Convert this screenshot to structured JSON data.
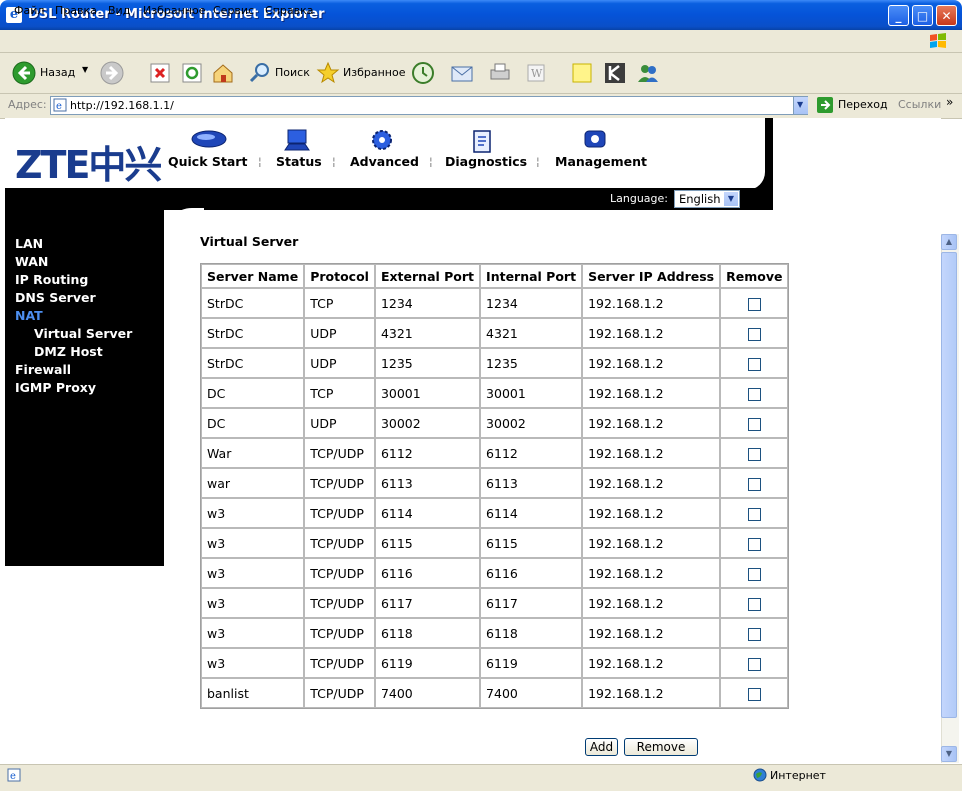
{
  "window": {
    "title": "DSL Router - Microsoft Internet Explorer"
  },
  "menu": [
    "Файл",
    "Правка",
    "Вид",
    "Избранное",
    "Сервис",
    "Справка"
  ],
  "toolbar": {
    "back": "Назад",
    "search": "Поиск",
    "favorites": "Избранное"
  },
  "address": {
    "label": "Адрес:",
    "url": "http://192.168.1.1/",
    "go": "Переход",
    "links": "Ссылки"
  },
  "header": {
    "logo": "ZTE中兴",
    "nav": [
      "Quick Start",
      "Status",
      "Advanced",
      "Diagnostics",
      "Management"
    ],
    "language_label": "Language:",
    "language_value": "English"
  },
  "sidebar": {
    "items": [
      {
        "label": "LAN"
      },
      {
        "label": "WAN"
      },
      {
        "label": "IP Routing"
      },
      {
        "label": "DNS Server"
      },
      {
        "label": "NAT"
      },
      {
        "label": "Virtual Server"
      },
      {
        "label": "DMZ Host"
      },
      {
        "label": "Firewall"
      },
      {
        "label": "IGMP Proxy"
      }
    ]
  },
  "page": {
    "heading": "Virtual Server",
    "columns": [
      "Server Name",
      "Protocol",
      "External Port",
      "Internal Port",
      "Server IP Address",
      "Remove"
    ],
    "rows": [
      [
        "StrDC",
        "TCP",
        "1234",
        "1234",
        "192.168.1.2"
      ],
      [
        "StrDC",
        "UDP",
        "4321",
        "4321",
        "192.168.1.2"
      ],
      [
        "StrDC",
        "UDP",
        "1235",
        "1235",
        "192.168.1.2"
      ],
      [
        "DC",
        "TCP",
        "30001",
        "30001",
        "192.168.1.2"
      ],
      [
        "DC",
        "UDP",
        "30002",
        "30002",
        "192.168.1.2"
      ],
      [
        "War",
        "TCP/UDP",
        "6112",
        "6112",
        "192.168.1.2"
      ],
      [
        "war",
        "TCP/UDP",
        "6113",
        "6113",
        "192.168.1.2"
      ],
      [
        "w3",
        "TCP/UDP",
        "6114",
        "6114",
        "192.168.1.2"
      ],
      [
        "w3",
        "TCP/UDP",
        "6115",
        "6115",
        "192.168.1.2"
      ],
      [
        "w3",
        "TCP/UDP",
        "6116",
        "6116",
        "192.168.1.2"
      ],
      [
        "w3",
        "TCP/UDP",
        "6117",
        "6117",
        "192.168.1.2"
      ],
      [
        "w3",
        "TCP/UDP",
        "6118",
        "6118",
        "192.168.1.2"
      ],
      [
        "w3",
        "TCP/UDP",
        "6119",
        "6119",
        "192.168.1.2"
      ],
      [
        "banlist",
        "TCP/UDP",
        "7400",
        "7400",
        "192.168.1.2"
      ]
    ],
    "add_label": "Add",
    "remove_label": "Remove"
  },
  "status": {
    "zone": "Интернет"
  }
}
